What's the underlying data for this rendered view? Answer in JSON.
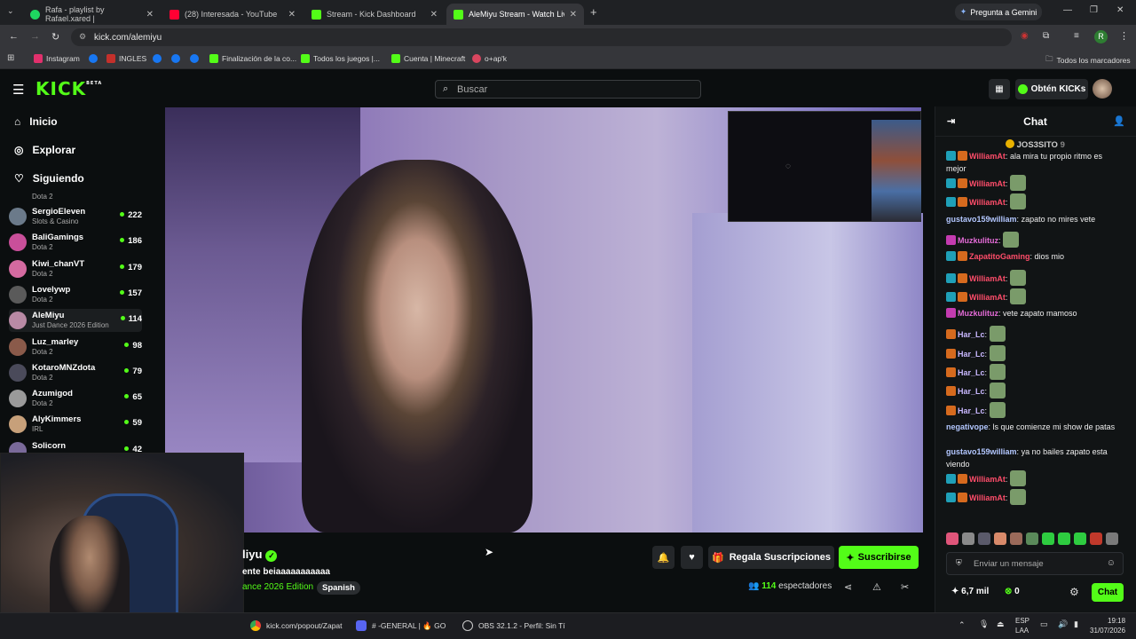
{
  "browser": {
    "tabs": [
      {
        "title": "Rafa - playlist by Rafael.xared |",
        "color": "#1ed760"
      },
      {
        "title": "(28) Interesada - YouTube",
        "color": "#ff0033"
      },
      {
        "title": "Stream - Kick Dashboard",
        "color": "#53fc18"
      },
      {
        "title": "AleMiyu Stream - Watch Live o",
        "color": "#53fc18"
      }
    ],
    "gemini_label": "Pregunta a Gemini",
    "url": "kick.com/alemiyu",
    "profile_initial": "R",
    "bookmarks": [
      {
        "label": "Instagram",
        "color": "#e1306c"
      },
      {
        "label": "",
        "color": "#1877f2"
      },
      {
        "label": "INGLES",
        "color": "#c4302b"
      },
      {
        "label": "",
        "color": "#1877f2"
      },
      {
        "label": "",
        "color": "#1877f2"
      },
      {
        "label": "",
        "color": "#1877f2"
      },
      {
        "label": "Finalización de la co...",
        "color": "#53fc18"
      },
      {
        "label": "Todos los juegos |...",
        "color": "#53fc18"
      },
      {
        "label": "Cuenta | Minecraft",
        "color": "#53fc18"
      },
      {
        "label": "o+ap'k",
        "color": "#d9465f"
      }
    ],
    "all_bookmarks": "Todos los marcadores"
  },
  "header": {
    "logo": "KICK",
    "logo_sup": "BETA",
    "search_placeholder": "Buscar",
    "get_kicks": "Obtén KICKs"
  },
  "sidebar": {
    "nav": [
      "Inicio",
      "Explorar",
      "Siguiendo"
    ],
    "top_partial_game": "Dota 2",
    "channels": [
      {
        "name": "SergioEleven",
        "game": "Slots & Casino",
        "viewers": "222",
        "color": "#6b7a8a"
      },
      {
        "name": "BaliGamings",
        "game": "Dota 2",
        "viewers": "186",
        "color": "#c94f9a"
      },
      {
        "name": "Kiwi_chanVT",
        "game": "Dota 2",
        "viewers": "179",
        "color": "#d46aa0"
      },
      {
        "name": "Lovelywp",
        "game": "Dota 2",
        "viewers": "157",
        "color": "#5a5a5a"
      },
      {
        "name": "AleMiyu",
        "game": "Just Dance 2026 Edition",
        "viewers": "114",
        "color": "#b98aa5"
      },
      {
        "name": "Luz_marley",
        "game": "Dota 2",
        "viewers": "98",
        "color": "#8a5a4a"
      },
      {
        "name": "KotaroMNZdota",
        "game": "Dota 2",
        "viewers": "79",
        "color": "#4a4a5a"
      },
      {
        "name": "Azumigod",
        "game": "Dota 2",
        "viewers": "65",
        "color": "#9a9a9a"
      },
      {
        "name": "AlyKimmers",
        "game": "IRL",
        "viewers": "59",
        "color": "#c7a07a"
      },
      {
        "name": "Solicorn",
        "game": "",
        "viewers": "42",
        "color": "#7a6a9a"
      }
    ]
  },
  "stream": {
    "name_partial": "liyu",
    "title_partial": "ente beiaaaaaaaaaaa",
    "category_partial": "ance 2026 Edition",
    "language": "Spanish",
    "gift_label": "Regala Suscripciones",
    "subscribe_label": "Suscribirse",
    "viewers_count": "114",
    "viewers_label": "espectadores"
  },
  "chat": {
    "title": "Chat",
    "pinned_user": "JOS3SITO",
    "pinned_num": "9",
    "messages": [
      {
        "user": "WilliamAt",
        "text": "ala mira tu propio ritmo es mejor",
        "color": "#ff4d6a",
        "emote": false
      },
      {
        "user": "WilliamAt",
        "text": "",
        "color": "#ff4d6a",
        "emote": true
      },
      {
        "user": "WilliamAt",
        "text": "",
        "color": "#ff4d6a",
        "emote": true
      },
      {
        "user": "gustavo159william",
        "text": "zapato no mires vete",
        "color": "#b3c7ff",
        "emote": false
      },
      {
        "user": "Muzkulituz",
        "text": "",
        "color": "#e36bd6",
        "emote": true
      },
      {
        "user": "ZapatitoGaming",
        "text": "dios mio",
        "color": "#ff4d6a",
        "emote": false
      },
      {
        "user": "WilliamAt",
        "text": "",
        "color": "#ff4d6a",
        "emote": true
      },
      {
        "user": "WilliamAt",
        "text": "",
        "color": "#ff4d6a",
        "emote": true
      },
      {
        "user": "Muzkulituz",
        "text": "vete zapato mamoso",
        "color": "#e36bd6",
        "emote": false
      },
      {
        "user": "Har_Lc",
        "text": "",
        "color": "#c9b8ff",
        "emote": true
      },
      {
        "user": "Har_Lc",
        "text": "",
        "color": "#c9b8ff",
        "emote": true
      },
      {
        "user": "Har_Lc",
        "text": "",
        "color": "#c9b8ff",
        "emote": true
      },
      {
        "user": "Har_Lc",
        "text": "",
        "color": "#c9b8ff",
        "emote": true
      },
      {
        "user": "Har_Lc",
        "text": "",
        "color": "#c9b8ff",
        "emote": true
      },
      {
        "user": "negativope",
        "text": "ls que comienze mi show de patas",
        "color": "#b3c7ff",
        "emote": false
      },
      {
        "user": "gustavo159william",
        "text": "ya no bailes zapato esta viendo",
        "color": "#b3c7ff",
        "emote": false
      },
      {
        "user": "WilliamAt",
        "text": "",
        "color": "#ff4d6a",
        "emote": true
      },
      {
        "user": "WilliamAt",
        "text": "",
        "color": "#ff4d6a",
        "emote": true
      }
    ],
    "input_placeholder": "Enviar un mensaje",
    "points": "6,7 mil",
    "kicks": "0",
    "send_label": "Chat"
  },
  "taskbar": {
    "items": [
      "kick.com/popout/Zapat",
      "# -GENERAL | 🔥 GO",
      "OBS 32.1.2 - Perfil: Sin Tí"
    ],
    "lang_top": "ESP",
    "lang_bottom": "LAA",
    "time": "19:18",
    "date": "31/07/2026"
  },
  "colors": {
    "accent": "#53fc18",
    "bg": "#0b0e0f",
    "chat_bg": "#111415"
  }
}
